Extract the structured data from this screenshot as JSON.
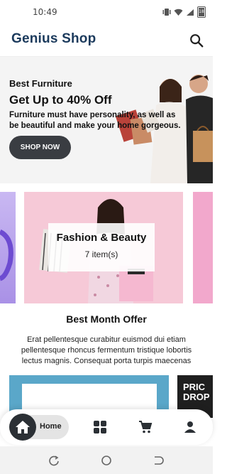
{
  "status_bar": {
    "time": "10:49",
    "battery": "18"
  },
  "app_bar": {
    "title": "Genius Shop"
  },
  "hero": {
    "eyebrow": "Best Furniture",
    "title": "Get Up to 40% Off",
    "description": "Furniture must have personality, as well as be beautiful and make your home gorgeous.",
    "button_label": "SHOP NOW"
  },
  "carousel": {
    "items": [
      {
        "name": "Fashion & Beauty",
        "count": "7 item(s)"
      }
    ]
  },
  "offer": {
    "title": "Best Month Offer",
    "text": "Erat pellentesque curabitur euismod dui etiam pellentesque rhoncus fermentum tristique lobortis lectus magnis. Consequat porta turpis maecenas"
  },
  "products": {
    "promo_text": "PRIC DROP"
  },
  "bottom_nav": {
    "items": [
      {
        "label": "Home",
        "icon": "home-icon",
        "active": true
      },
      {
        "label": "",
        "icon": "grid-icon"
      },
      {
        "label": "",
        "icon": "cart-icon"
      },
      {
        "label": "",
        "icon": "person-icon"
      }
    ]
  },
  "colors": {
    "brand": "#1b3a5c",
    "button": "#3a3d42",
    "nav_active": "#2b3035",
    "card": "#f6c9d7"
  }
}
